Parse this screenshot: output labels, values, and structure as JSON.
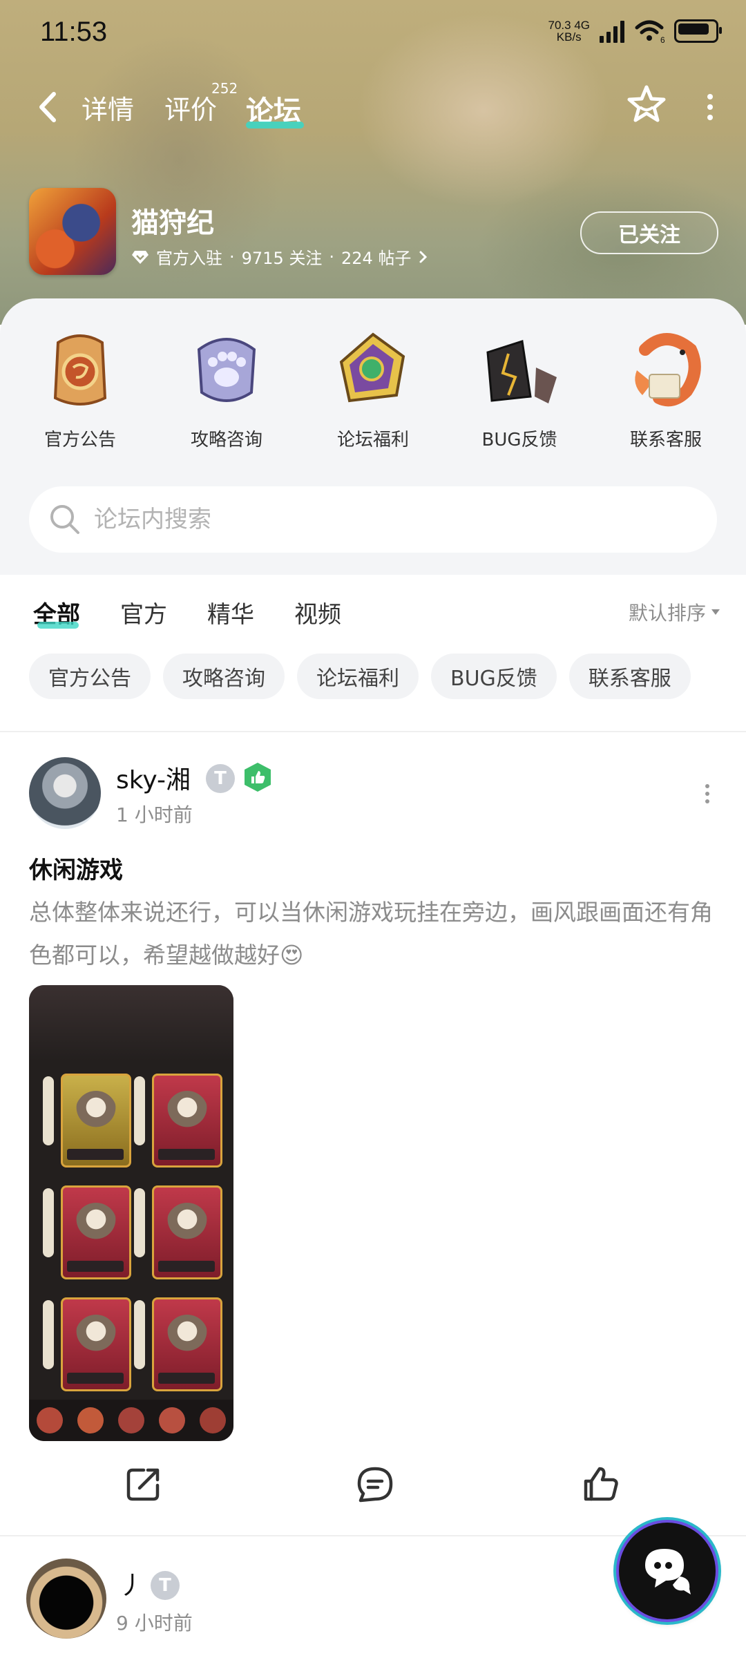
{
  "status_bar": {
    "time": "11:53",
    "net_speed": "70.3",
    "net_unit": "KB/s",
    "net_type": "4G",
    "signal_sub": "6"
  },
  "nav": {
    "tabs": [
      {
        "label": "详情"
      },
      {
        "label": "评价"
      },
      {
        "label": "论坛"
      }
    ],
    "review_count": "252",
    "active_tab": "论坛"
  },
  "app": {
    "name": "猫狩纪",
    "verified": "官方入驻",
    "follows": "9715 关注",
    "posts": "224 帖子",
    "separator": "·",
    "follow_button": "已关注"
  },
  "categories": [
    {
      "label": "官方公告",
      "icon": "announcement-icon"
    },
    {
      "label": "攻略咨询",
      "icon": "paw-badge-icon"
    },
    {
      "label": "论坛福利",
      "icon": "gem-medal-icon"
    },
    {
      "label": "BUG反馈",
      "icon": "cracked-stone-icon"
    },
    {
      "label": "联系客服",
      "icon": "koi-fish-icon"
    }
  ],
  "search": {
    "placeholder": "论坛内搜索"
  },
  "filter_tabs": {
    "items": [
      "全部",
      "官方",
      "精华",
      "视频"
    ],
    "active": "全部",
    "sort_label": "默认排序"
  },
  "chips": [
    "官方公告",
    "攻略咨询",
    "论坛福利",
    "BUG反馈",
    "联系客服"
  ],
  "posts": [
    {
      "username": "sky-湘",
      "level": "T1",
      "time": "1 小时前",
      "title": "休闲游戏",
      "body": "总体整体来说还行，可以当休闲游戏玩挂在旁边，画风跟画面还有角色都可以，希望越做越好",
      "emoji": "😍"
    },
    {
      "username": "丿",
      "level": "T2",
      "time": "9 小时前"
    }
  ],
  "colors": {
    "accent": "#3dd6c4",
    "like_badge": "#3dbe6a",
    "muted_text": "#8c8c8c"
  }
}
